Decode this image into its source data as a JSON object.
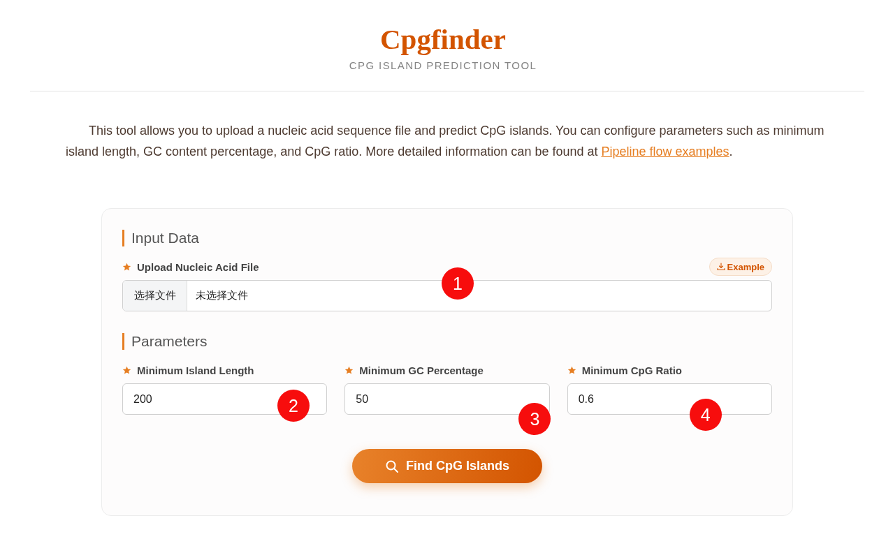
{
  "header": {
    "title": "Cpgfinder",
    "subtitle": "CPG ISLAND PREDICTION TOOL"
  },
  "intro": {
    "text_before": "This tool allows you to upload a nucleic acid sequence file and predict CpG islands. You can configure parameters such as minimum island length, GC content percentage, and CpG ratio. More detailed information can be found at ",
    "link": "Pipeline flow examples",
    "text_after": "."
  },
  "form": {
    "sections": [
      {
        "title": "Input Data",
        "fields": [
          {
            "kind": "file",
            "label": "Upload Nucleic Acid File",
            "required": true,
            "action": "Example",
            "button": "选择文件",
            "status": "未选择文件",
            "marker": "1"
          }
        ]
      },
      {
        "title": "Parameters",
        "fields": [
          {
            "kind": "number",
            "label": "Minimum Island Length",
            "required": true,
            "value": "200",
            "marker": "2"
          },
          {
            "kind": "number",
            "label": "Minimum GC Percentage",
            "required": true,
            "value": "50",
            "marker": "3"
          },
          {
            "kind": "number",
            "label": "Minimum CpG Ratio",
            "required": true,
            "value": "0.6",
            "marker": "4"
          }
        ]
      }
    ],
    "submit": "Find CpG Islands"
  }
}
